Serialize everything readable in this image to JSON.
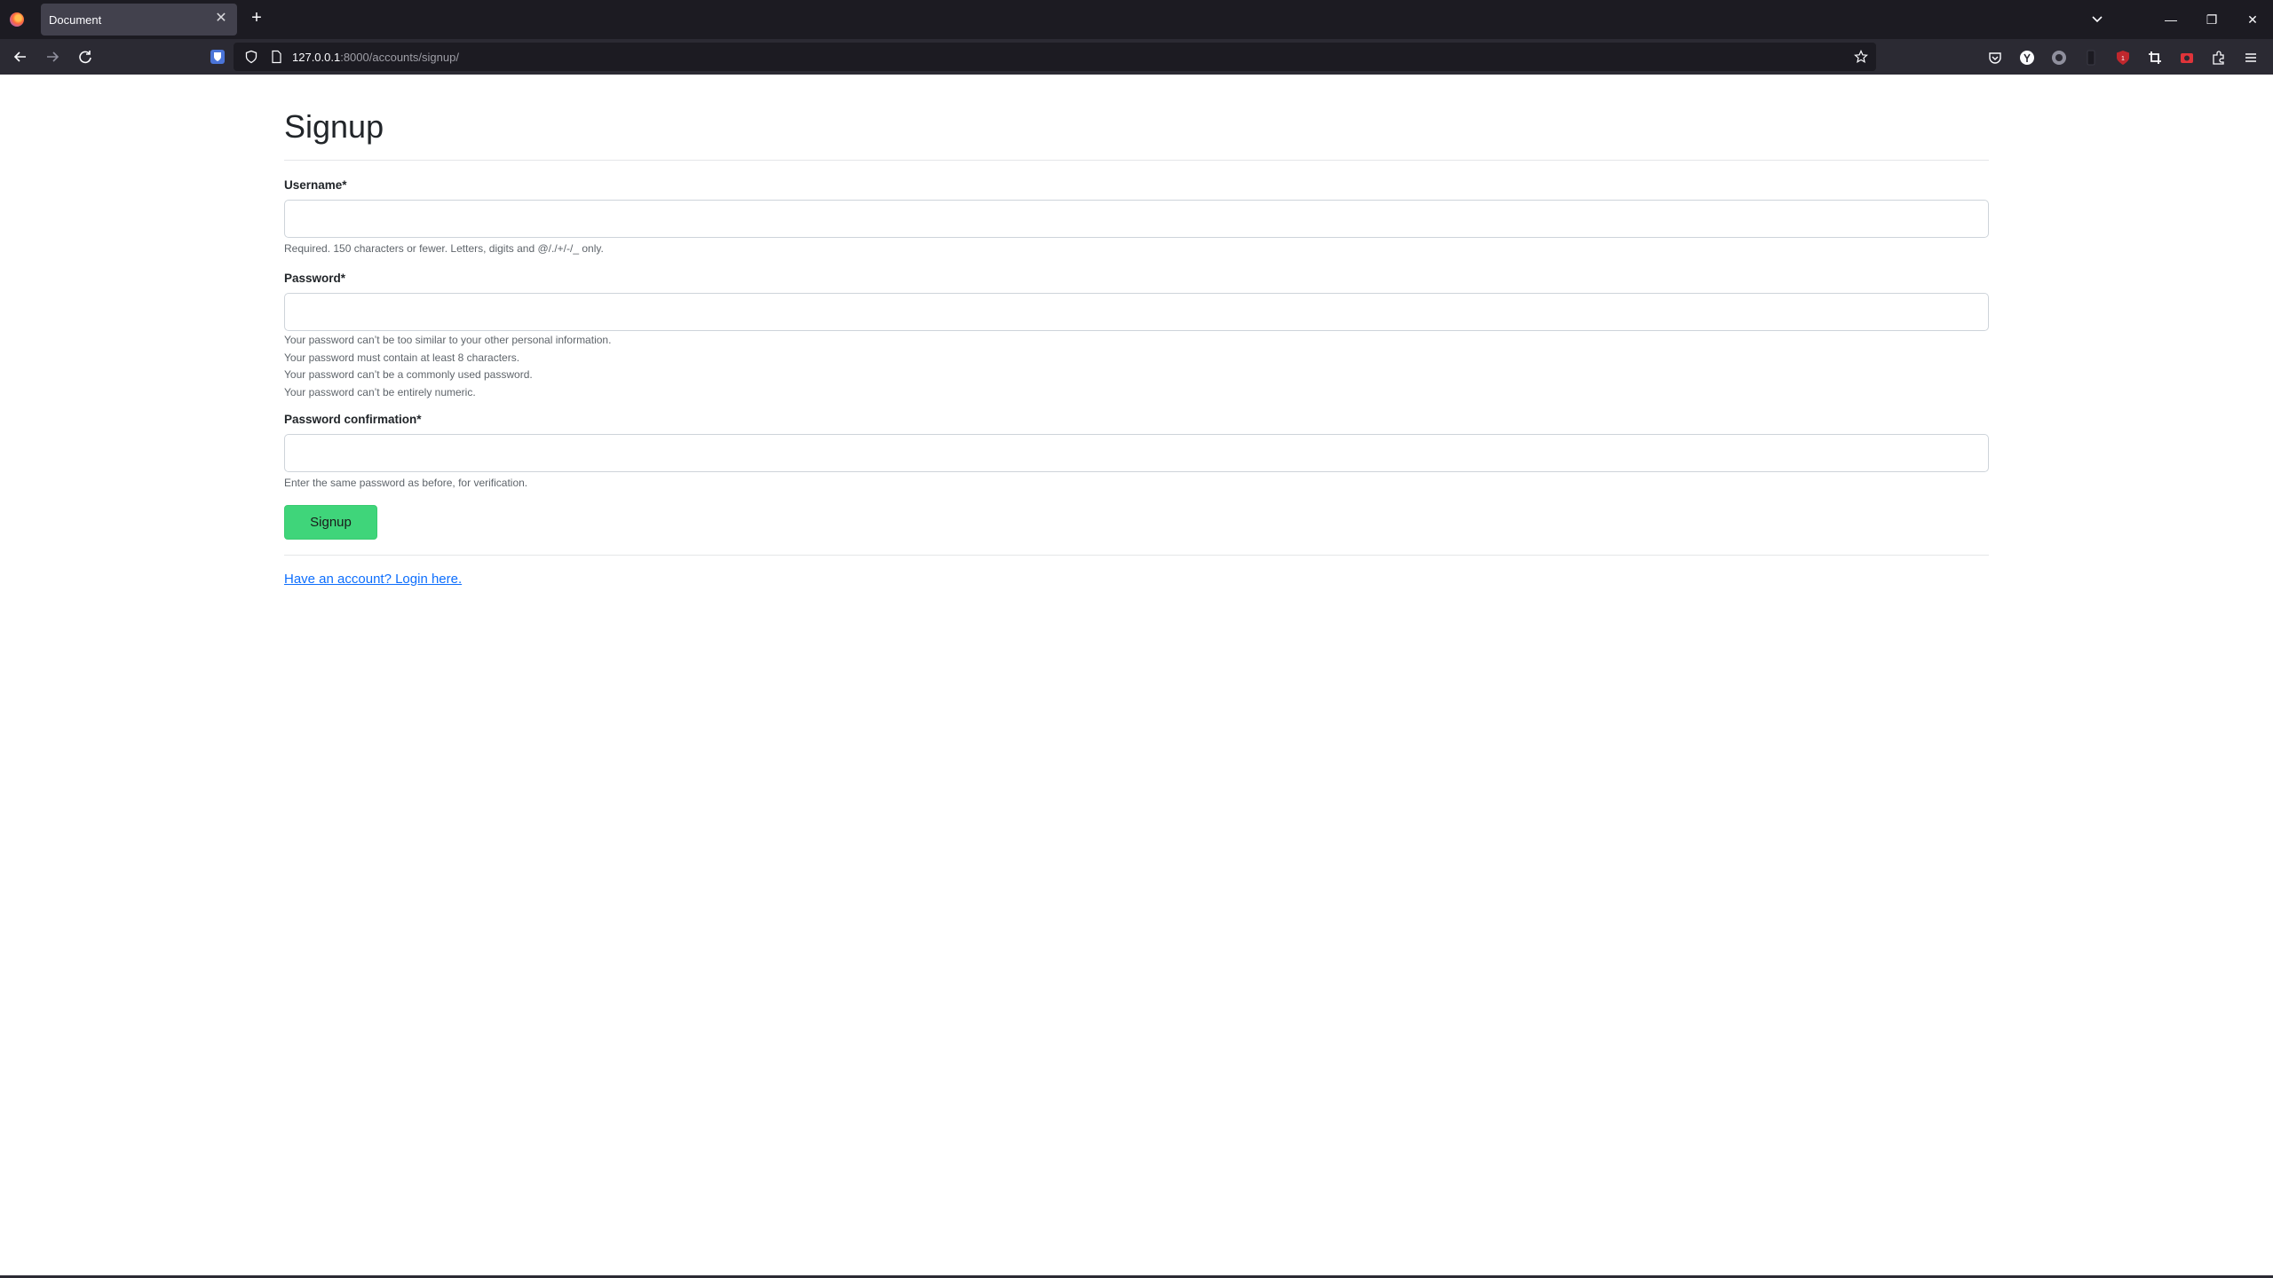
{
  "browser": {
    "tab_title": "Document",
    "url_host": "127.0.0.1",
    "url_path": ":8000/accounts/signup/",
    "icons": {
      "new_tab": "plus-icon",
      "tab_close": "close-icon",
      "tab_list": "chevron-down-icon",
      "back": "arrow-left-icon",
      "forward": "arrow-right-icon",
      "reload": "reload-icon",
      "bookmark": "star-icon",
      "menu": "hamburger-menu-icon"
    },
    "window_controls": {
      "minimize": "—",
      "restore": "❐",
      "close": "✕"
    }
  },
  "page": {
    "title": "Signup",
    "fields": {
      "username": {
        "label": "Username",
        "required_mark": "*",
        "value": "",
        "help": "Required. 150 characters or fewer. Letters, digits and @/./+/-/_ only."
      },
      "password": {
        "label": "Password",
        "required_mark": "*",
        "value": "",
        "help": [
          "Your password can’t be too similar to your other personal information.",
          "Your password must contain at least 8 characters.",
          "Your password can’t be a commonly used password.",
          "Your password can’t be entirely numeric."
        ]
      },
      "password_confirmation": {
        "label": "Password confirmation",
        "required_mark": "*",
        "value": "",
        "help": "Enter the same password as before, for verification."
      }
    },
    "submit_label": "Signup",
    "login_link": "Have an account? Login here."
  },
  "colors": {
    "button_bg": "#3fd57a",
    "link": "#0d6efd",
    "chrome_dark": "#1c1b22",
    "chrome_toolbar": "#2b2a33"
  }
}
